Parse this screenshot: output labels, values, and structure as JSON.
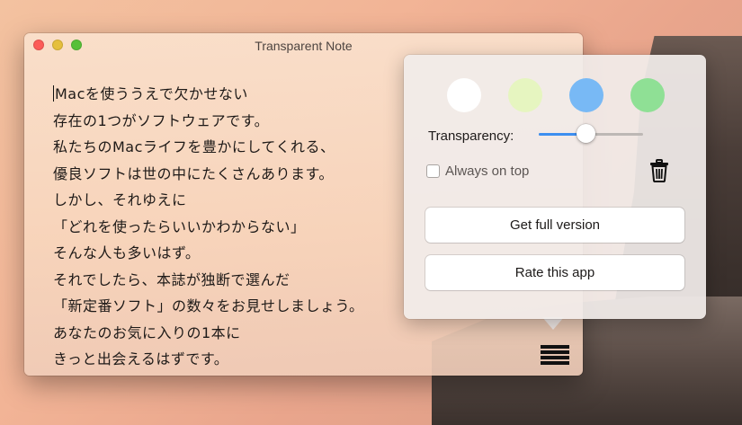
{
  "window": {
    "title": "Transparent Note",
    "note_lines": [
      "Macを使ううえで欠かせない",
      "存在の1つがソフトウェアです。",
      "私たちのMacライフを豊かにしてくれる、",
      "優良ソフトは世の中にたくさんあります。",
      "しかし、それゆえに",
      "「どれを使ったらいいかわからない」",
      "そんな人も多いはず。",
      "それでしたら、本誌が独断で選んだ",
      "「新定番ソフト」の数々をお見せしましょう。",
      "あなたのお気に入りの1本に",
      "きっと出会えるはずです。"
    ]
  },
  "popover": {
    "swatches": [
      "#ffffff",
      "#e6f5c0",
      "#78b9f5",
      "#8fe095"
    ],
    "transparency_label": "Transparency:",
    "transparency_value": 0.45,
    "always_on_top_label": "Always on top",
    "always_on_top_checked": false,
    "trash_icon": "trash-icon",
    "get_full_version_label": "Get full version",
    "rate_app_label": "Rate this app"
  },
  "list_icon": "list-icon",
  "colors": {
    "slider_fill": "#3d8ff0",
    "close": "#fc5b57",
    "minimize": "#e5bf3c",
    "zoom": "#57c038"
  }
}
